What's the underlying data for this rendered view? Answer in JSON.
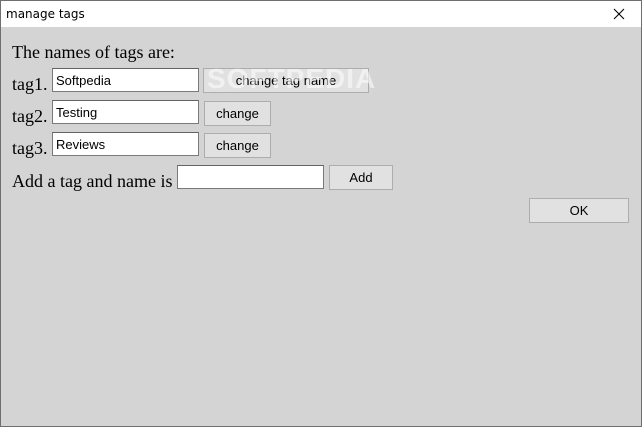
{
  "window": {
    "title": "manage tags",
    "close_icon": "close-icon"
  },
  "content": {
    "heading": "The names of tags are:",
    "tags": [
      {
        "label": "tag1.",
        "value": "Softpedia",
        "button": "change tag name"
      },
      {
        "label": "tag2.",
        "value": "Testing",
        "button": "change"
      },
      {
        "label": "tag3.",
        "value": "Reviews",
        "button": "change"
      }
    ],
    "add_label": "Add a tag and name is",
    "add_value": "",
    "add_button": "Add",
    "ok_button": "OK"
  },
  "watermark": "SOFTPEDIA"
}
